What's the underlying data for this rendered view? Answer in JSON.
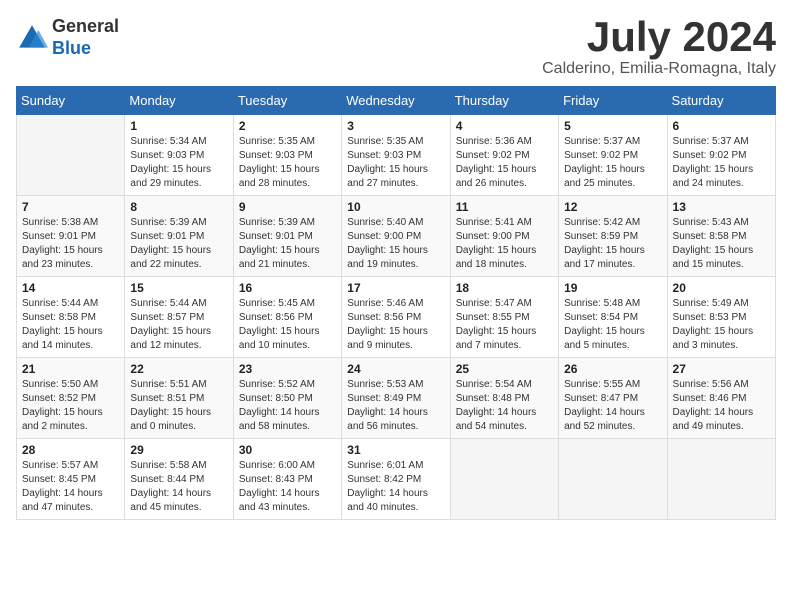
{
  "logo": {
    "line1": "General",
    "line2": "Blue"
  },
  "title": "July 2024",
  "location": "Calderino, Emilia-Romagna, Italy",
  "weekdays": [
    "Sunday",
    "Monday",
    "Tuesday",
    "Wednesday",
    "Thursday",
    "Friday",
    "Saturday"
  ],
  "weeks": [
    [
      {
        "day": "",
        "detail": ""
      },
      {
        "day": "1",
        "detail": "Sunrise: 5:34 AM\nSunset: 9:03 PM\nDaylight: 15 hours\nand 29 minutes."
      },
      {
        "day": "2",
        "detail": "Sunrise: 5:35 AM\nSunset: 9:03 PM\nDaylight: 15 hours\nand 28 minutes."
      },
      {
        "day": "3",
        "detail": "Sunrise: 5:35 AM\nSunset: 9:03 PM\nDaylight: 15 hours\nand 27 minutes."
      },
      {
        "day": "4",
        "detail": "Sunrise: 5:36 AM\nSunset: 9:02 PM\nDaylight: 15 hours\nand 26 minutes."
      },
      {
        "day": "5",
        "detail": "Sunrise: 5:37 AM\nSunset: 9:02 PM\nDaylight: 15 hours\nand 25 minutes."
      },
      {
        "day": "6",
        "detail": "Sunrise: 5:37 AM\nSunset: 9:02 PM\nDaylight: 15 hours\nand 24 minutes."
      }
    ],
    [
      {
        "day": "7",
        "detail": "Sunrise: 5:38 AM\nSunset: 9:01 PM\nDaylight: 15 hours\nand 23 minutes."
      },
      {
        "day": "8",
        "detail": "Sunrise: 5:39 AM\nSunset: 9:01 PM\nDaylight: 15 hours\nand 22 minutes."
      },
      {
        "day": "9",
        "detail": "Sunrise: 5:39 AM\nSunset: 9:01 PM\nDaylight: 15 hours\nand 21 minutes."
      },
      {
        "day": "10",
        "detail": "Sunrise: 5:40 AM\nSunset: 9:00 PM\nDaylight: 15 hours\nand 19 minutes."
      },
      {
        "day": "11",
        "detail": "Sunrise: 5:41 AM\nSunset: 9:00 PM\nDaylight: 15 hours\nand 18 minutes."
      },
      {
        "day": "12",
        "detail": "Sunrise: 5:42 AM\nSunset: 8:59 PM\nDaylight: 15 hours\nand 17 minutes."
      },
      {
        "day": "13",
        "detail": "Sunrise: 5:43 AM\nSunset: 8:58 PM\nDaylight: 15 hours\nand 15 minutes."
      }
    ],
    [
      {
        "day": "14",
        "detail": "Sunrise: 5:44 AM\nSunset: 8:58 PM\nDaylight: 15 hours\nand 14 minutes."
      },
      {
        "day": "15",
        "detail": "Sunrise: 5:44 AM\nSunset: 8:57 PM\nDaylight: 15 hours\nand 12 minutes."
      },
      {
        "day": "16",
        "detail": "Sunrise: 5:45 AM\nSunset: 8:56 PM\nDaylight: 15 hours\nand 10 minutes."
      },
      {
        "day": "17",
        "detail": "Sunrise: 5:46 AM\nSunset: 8:56 PM\nDaylight: 15 hours\nand 9 minutes."
      },
      {
        "day": "18",
        "detail": "Sunrise: 5:47 AM\nSunset: 8:55 PM\nDaylight: 15 hours\nand 7 minutes."
      },
      {
        "day": "19",
        "detail": "Sunrise: 5:48 AM\nSunset: 8:54 PM\nDaylight: 15 hours\nand 5 minutes."
      },
      {
        "day": "20",
        "detail": "Sunrise: 5:49 AM\nSunset: 8:53 PM\nDaylight: 15 hours\nand 3 minutes."
      }
    ],
    [
      {
        "day": "21",
        "detail": "Sunrise: 5:50 AM\nSunset: 8:52 PM\nDaylight: 15 hours\nand 2 minutes."
      },
      {
        "day": "22",
        "detail": "Sunrise: 5:51 AM\nSunset: 8:51 PM\nDaylight: 15 hours\nand 0 minutes."
      },
      {
        "day": "23",
        "detail": "Sunrise: 5:52 AM\nSunset: 8:50 PM\nDaylight: 14 hours\nand 58 minutes."
      },
      {
        "day": "24",
        "detail": "Sunrise: 5:53 AM\nSunset: 8:49 PM\nDaylight: 14 hours\nand 56 minutes."
      },
      {
        "day": "25",
        "detail": "Sunrise: 5:54 AM\nSunset: 8:48 PM\nDaylight: 14 hours\nand 54 minutes."
      },
      {
        "day": "26",
        "detail": "Sunrise: 5:55 AM\nSunset: 8:47 PM\nDaylight: 14 hours\nand 52 minutes."
      },
      {
        "day": "27",
        "detail": "Sunrise: 5:56 AM\nSunset: 8:46 PM\nDaylight: 14 hours\nand 49 minutes."
      }
    ],
    [
      {
        "day": "28",
        "detail": "Sunrise: 5:57 AM\nSunset: 8:45 PM\nDaylight: 14 hours\nand 47 minutes."
      },
      {
        "day": "29",
        "detail": "Sunrise: 5:58 AM\nSunset: 8:44 PM\nDaylight: 14 hours\nand 45 minutes."
      },
      {
        "day": "30",
        "detail": "Sunrise: 6:00 AM\nSunset: 8:43 PM\nDaylight: 14 hours\nand 43 minutes."
      },
      {
        "day": "31",
        "detail": "Sunrise: 6:01 AM\nSunset: 8:42 PM\nDaylight: 14 hours\nand 40 minutes."
      },
      {
        "day": "",
        "detail": ""
      },
      {
        "day": "",
        "detail": ""
      },
      {
        "day": "",
        "detail": ""
      }
    ]
  ]
}
